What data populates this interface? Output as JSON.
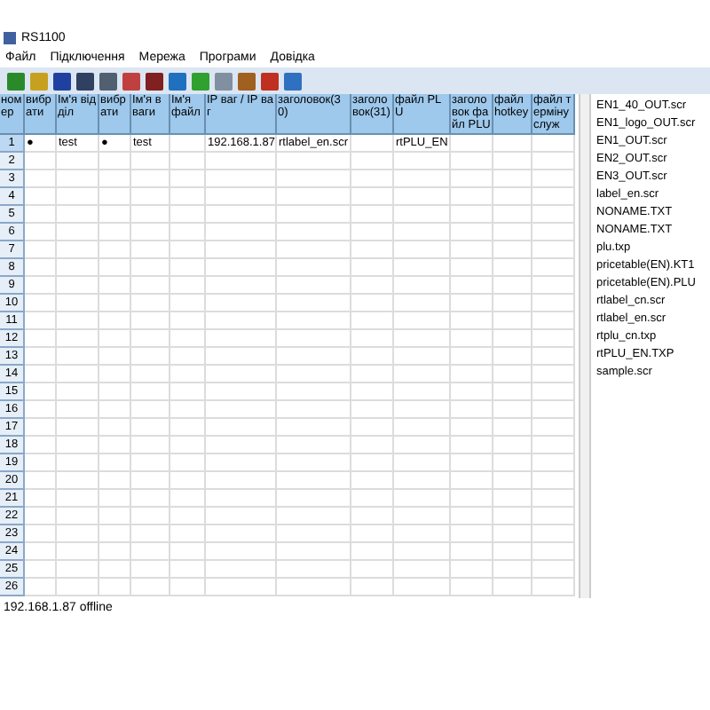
{
  "window": {
    "title": "RS1100"
  },
  "menu": [
    "Файл",
    "Підключення",
    "Мережа",
    "Програми",
    "Довідка"
  ],
  "table": {
    "columns": [
      "номер",
      "вибрати",
      "Ім'я відділ",
      "вибрати",
      "Ім'я в ваги",
      "Ім'я файл",
      "IP ваг / IP ваг",
      "заголовок(30)",
      "заголовок(31)",
      "файл PLU",
      "заголовок файл PLU",
      "файл hotkey",
      "файл терміну служ"
    ],
    "rows": [
      {
        "selected": true,
        "cells": [
          "1",
          "●",
          "test",
          "●",
          "test",
          "",
          "192.168.1.87",
          "rtlabel_en.scr",
          "",
          "rtPLU_EN"
        ]
      },
      {
        "selected": false,
        "cells": [
          "2"
        ]
      },
      {
        "selected": false,
        "cells": [
          "3"
        ]
      },
      {
        "selected": false,
        "cells": [
          "4"
        ]
      },
      {
        "selected": false,
        "cells": [
          "5"
        ]
      },
      {
        "selected": false,
        "cells": [
          "6"
        ]
      },
      {
        "selected": false,
        "cells": [
          "7"
        ]
      },
      {
        "selected": false,
        "cells": [
          "8"
        ]
      },
      {
        "selected": false,
        "cells": [
          "9"
        ]
      },
      {
        "selected": false,
        "cells": [
          "10"
        ]
      },
      {
        "selected": false,
        "cells": [
          "11"
        ]
      },
      {
        "selected": false,
        "cells": [
          "12"
        ]
      },
      {
        "selected": false,
        "cells": [
          "13"
        ]
      },
      {
        "selected": false,
        "cells": [
          "14"
        ]
      },
      {
        "selected": false,
        "cells": [
          "15"
        ]
      },
      {
        "selected": false,
        "cells": [
          "16"
        ]
      },
      {
        "selected": false,
        "cells": [
          "17"
        ]
      },
      {
        "selected": false,
        "cells": [
          "18"
        ]
      },
      {
        "selected": false,
        "cells": [
          "19"
        ]
      },
      {
        "selected": false,
        "cells": [
          "20"
        ]
      },
      {
        "selected": false,
        "cells": [
          "21"
        ]
      },
      {
        "selected": false,
        "cells": [
          "22"
        ]
      },
      {
        "selected": false,
        "cells": [
          "23"
        ]
      },
      {
        "selected": false,
        "cells": [
          "24"
        ]
      },
      {
        "selected": false,
        "cells": [
          "25"
        ]
      },
      {
        "selected": false,
        "cells": [
          "26"
        ]
      }
    ]
  },
  "files": [
    "EN1_40_OUT.scr",
    "EN1_logo_OUT.scr",
    "EN1_OUT.scr",
    "EN2_OUT.scr",
    "EN3_OUT.scr",
    "label_en.scr",
    "NONAME.TXT",
    "NONAME.TXT",
    "plu.txp",
    "pricetable(EN).KT1",
    "pricetable(EN).PLU",
    "rtlabel_cn.scr",
    "rtlabel_en.scr",
    "rtplu_cn.txp",
    "rtPLU_EN.TXP",
    "sample.scr"
  ],
  "status_bar": "192.168.1.87 offline"
}
